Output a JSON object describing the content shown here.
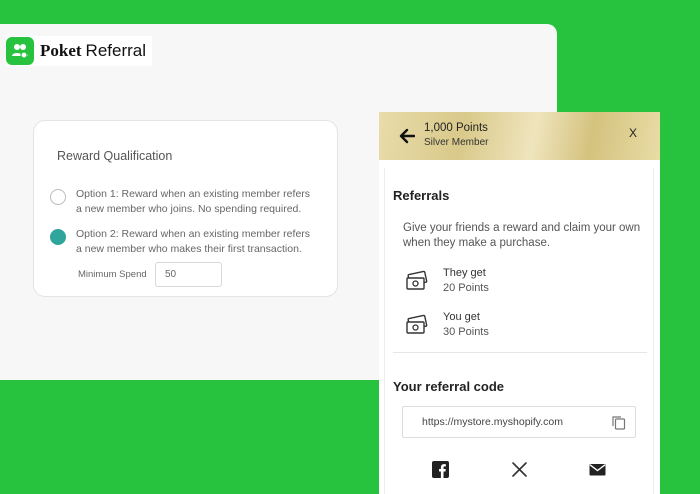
{
  "brand": {
    "name_bold": "Poket",
    "name_light": "Referral"
  },
  "reward_qualification": {
    "title": "Reward Qualification",
    "options": [
      {
        "label": "Option 1: Reward when an existing member refers a new member who joins. No spending required.",
        "selected": false
      },
      {
        "label": "Option 2: Reward when an existing member refers a new member who makes their first transaction.",
        "selected": true
      }
    ],
    "minimum_spend_label": "Minimum Spend",
    "minimum_spend_value": "50"
  },
  "widget": {
    "points_title": "1,000 Points",
    "member_level": "Silver Member",
    "close_label": "X",
    "referrals_heading": "Referrals",
    "referrals_description": "Give your friends a reward and claim your own when they make a purchase.",
    "benefits": [
      {
        "label": "They get",
        "value": "20 Points",
        "icon": "money-icon"
      },
      {
        "label": "You get",
        "value": "30 Points",
        "icon": "money-icon"
      }
    ],
    "referral_code_heading": "Your referral code",
    "referral_code": "https://mystore.myshopify.com",
    "share_icons": [
      "facebook-icon",
      "x-twitter-icon",
      "email-icon"
    ]
  },
  "colors": {
    "background": "#27c33f",
    "accent_radio": "#2fa59c",
    "brand_logo": "#27c33f"
  }
}
